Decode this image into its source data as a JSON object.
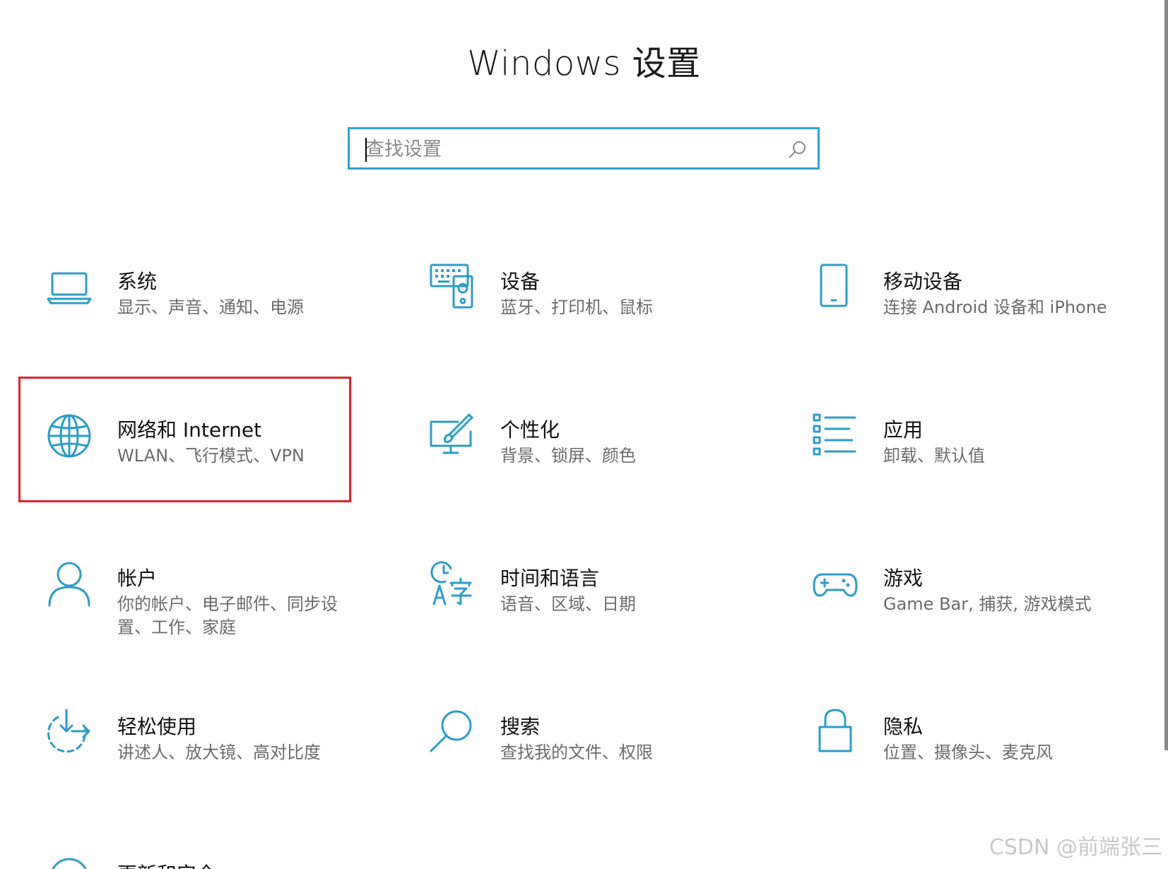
{
  "window": {
    "title": "Windows 设置"
  },
  "search": {
    "placeholder": "查找设置",
    "value": ""
  },
  "tiles": [
    {
      "icon": "laptop-icon",
      "title": "系统",
      "desc": "显示、声音、通知、电源"
    },
    {
      "icon": "devices-icon",
      "title": "设备",
      "desc": "蓝牙、打印机、鼠标"
    },
    {
      "icon": "phone-icon",
      "title": "移动设备",
      "desc": "连接 Android 设备和 iPhone"
    },
    {
      "icon": "globe-icon",
      "title": "网络和 Internet",
      "desc": "WLAN、飞行模式、VPN"
    },
    {
      "icon": "personalization-icon",
      "title": "个性化",
      "desc": "背景、锁屏、颜色"
    },
    {
      "icon": "apps-icon",
      "title": "应用",
      "desc": "卸载、默认值"
    },
    {
      "icon": "account-icon",
      "title": "帐户",
      "desc": "你的帐户、电子邮件、同步设置、工作、家庭"
    },
    {
      "icon": "time-language-icon",
      "title": "时间和语言",
      "desc": "语音、区域、日期"
    },
    {
      "icon": "gamepad-icon",
      "title": "游戏",
      "desc": "Game Bar, 捕获, 游戏模式"
    },
    {
      "icon": "ease-of-access-icon",
      "title": "轻松使用",
      "desc": "讲述人、放大镜、高对比度"
    },
    {
      "icon": "search-icon",
      "title": "搜索",
      "desc": "查找我的文件、权限"
    },
    {
      "icon": "lock-icon",
      "title": "隐私",
      "desc": "位置、摄像头、麦克风"
    },
    {
      "icon": "update-icon",
      "title": "更新和安全",
      "desc": ""
    }
  ],
  "watermark": "CSDN @前端张三",
  "colors": {
    "accent": "#2c9dc7",
    "highlight": "#e4212a"
  }
}
